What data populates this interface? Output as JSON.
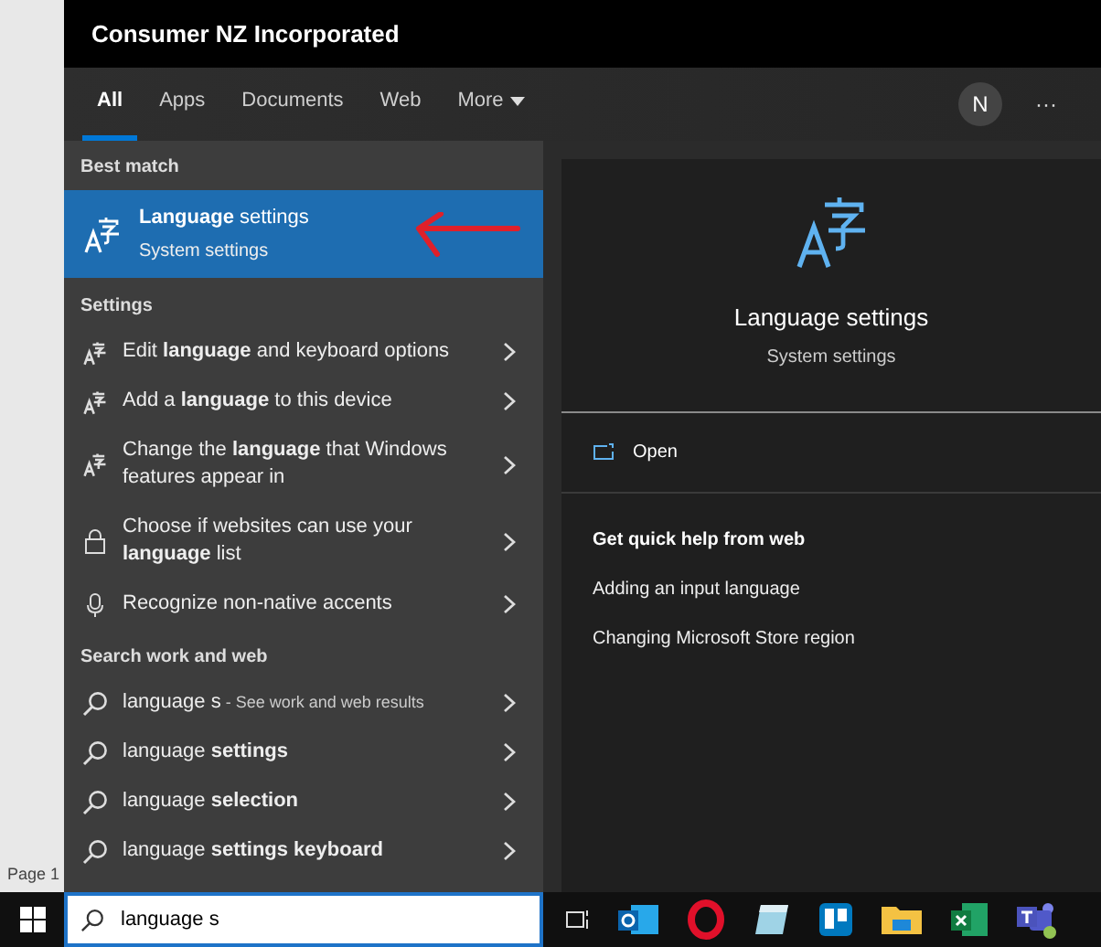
{
  "document": {
    "page_label": "Page 1"
  },
  "header": {
    "title": "Consumer NZ Incorporated"
  },
  "tabs": [
    {
      "label": "All",
      "selected": true,
      "kind": "plain"
    },
    {
      "label": "Apps",
      "selected": false,
      "kind": "plain"
    },
    {
      "label": "Documents",
      "selected": false,
      "kind": "plain"
    },
    {
      "label": "Web",
      "selected": false,
      "kind": "plain"
    },
    {
      "label": "More",
      "selected": false,
      "kind": "dropdown"
    }
  ],
  "account": {
    "initial": "N",
    "more": "···"
  },
  "best_match": {
    "heading": "Best match",
    "title": "**Language** settings",
    "subtitle": "System settings",
    "selected": true
  },
  "sections": [
    {
      "heading": "Settings",
      "items": [
        {
          "kind": "language",
          "text": "Edit **language** and keyboard options"
        },
        {
          "kind": "language",
          "text": "Add a **language** to this device"
        },
        {
          "kind": "language",
          "text": "Change the **language** that Windows features appear in"
        },
        {
          "kind": "lock",
          "text": "Choose if websites can use your **language** list"
        },
        {
          "kind": "mic",
          "text": "Recognize non-native accents"
        }
      ]
    },
    {
      "heading": "Search work and web",
      "items": [
        {
          "kind": "search",
          "text": "language s",
          "hint": "- See work and web results"
        },
        {
          "kind": "search",
          "text": "language **settings**"
        },
        {
          "kind": "search",
          "text": "language **selection**"
        },
        {
          "kind": "search",
          "text": "language **settings keyboard**"
        }
      ]
    }
  ],
  "preview": {
    "title": "Language settings",
    "subtitle": "System settings",
    "actions": [
      {
        "label": "Open"
      }
    ],
    "help_heading": "Get quick help from web",
    "help_links": [
      "Adding an input language",
      "Changing Microsoft Store region"
    ]
  },
  "search": {
    "value": "language s"
  }
}
